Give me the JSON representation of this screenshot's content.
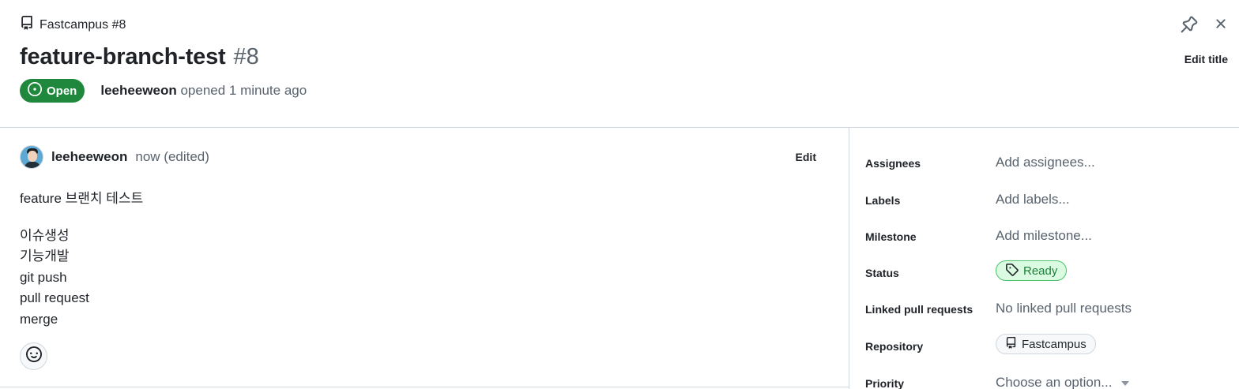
{
  "header": {
    "breadcrumb": "Fastcampus #8",
    "title": "feature-branch-test",
    "number": "#8",
    "status": "Open",
    "author": "leeheeweon",
    "opened_text": "opened 1 minute ago",
    "edit_title_label": "Edit title"
  },
  "comment": {
    "author": "leeheeweon",
    "meta": "now (edited)",
    "edit_label": "Edit",
    "body_first": "feature 브랜치 테스트",
    "body_lines": [
      "이슈생성",
      "기능개발",
      "git push",
      "pull request",
      "merge"
    ]
  },
  "sidebar": {
    "fields": [
      {
        "label": "Assignees",
        "value": "Add assignees..."
      },
      {
        "label": "Labels",
        "value": "Add labels..."
      },
      {
        "label": "Milestone",
        "value": "Add milestone..."
      },
      {
        "label": "Status",
        "value": "Ready"
      },
      {
        "label": "Linked pull requests",
        "value": "No linked pull requests"
      },
      {
        "label": "Repository",
        "value": "Fastcampus"
      },
      {
        "label": "Priority",
        "value": "Choose an option..."
      }
    ]
  },
  "icons": {
    "breadcrumb": "repo-icon",
    "status": "issue-opened-icon",
    "pin": "pin-icon",
    "close": "close-icon",
    "reaction": "smiley-icon",
    "ready": "tag-icon",
    "repository": "repo-icon",
    "priority": "chevron-down-icon"
  },
  "colors": {
    "open_badge": "#1f883d",
    "ready_bg": "#dafbe1",
    "ready_text": "#1a7f37",
    "border": "#d0d7de",
    "muted_text": "#59636e"
  }
}
